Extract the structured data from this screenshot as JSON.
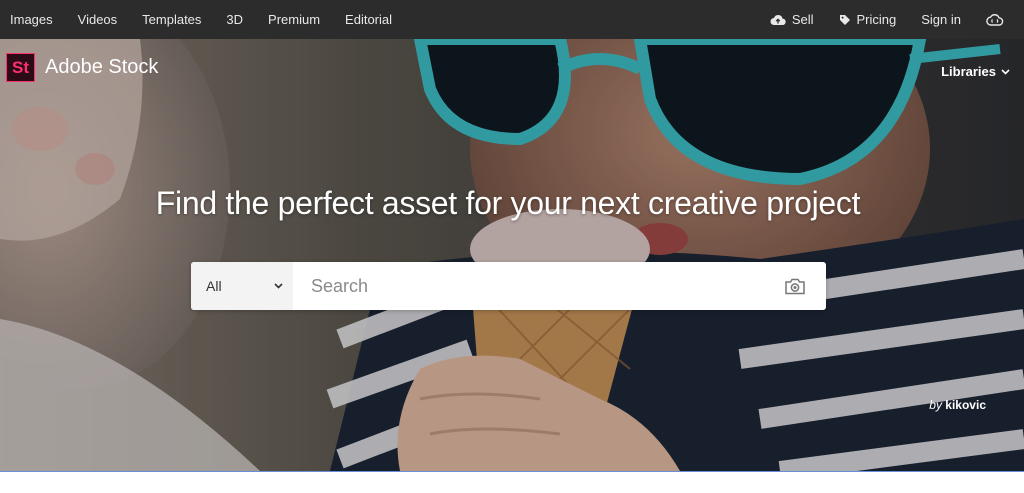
{
  "topnav": {
    "left_items": [
      "Images",
      "Videos",
      "Templates",
      "3D",
      "Premium",
      "Editorial"
    ],
    "sell": "Sell",
    "pricing": "Pricing",
    "sign_in": "Sign in"
  },
  "brand": {
    "logo_text": "St",
    "name": "Adobe Stock"
  },
  "libraries": "Libraries",
  "headline": "Find the perfect asset for your next creative project",
  "search": {
    "category": "All",
    "placeholder": "Search"
  },
  "credit": {
    "by": "by",
    "author": "kikovic"
  },
  "colors": {
    "nav_bg": "#2c2c2c",
    "brand_accent": "#ff2e6e",
    "link_underline": "#6a8fd8"
  },
  "icons": {
    "sell": "cloud-upload-icon",
    "pricing": "tag-icon",
    "creative_cloud": "creative-cloud-icon",
    "category_caret": "chevron-down-icon",
    "visual_search": "camera-icon",
    "libraries_caret": "chevron-down-icon"
  }
}
